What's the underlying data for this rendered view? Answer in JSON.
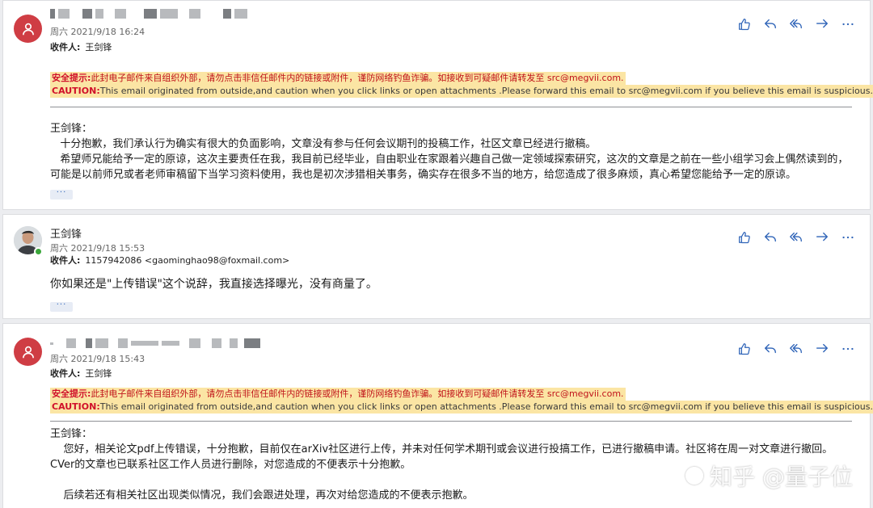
{
  "messages": [
    {
      "date": "周六 2021/9/18 16:24",
      "recipient_label": "收件人:",
      "recipient_value": "王剑锋",
      "security_label": "安全提示:",
      "security_text": "此封电子邮件来自组织外部，请勿点击非信任邮件内的链接或附件，谨防网络钓鱼诈骗。如接收到可疑邮件请转发至 src@megvii.com.",
      "caution_label": "CAUTION:",
      "caution_text": "This email originated from outside,and caution when you click links or open attachments .Please forward this email to src@megvii.com if you believe this email is suspicious.",
      "body": [
        "王剑锋：",
        "   十分抱歉，我们承认行为确实有很大的负面影响，文章没有参与任何会议期刊的投稿工作，社区文章已经进行撤稿。",
        "   希望师兄能给予一定的原谅，这次主要责任在我，我目前已经毕业，自由职业在家跟着兴趣自己做一定领域探索研究，这次的文章是之前在一些小组学习会上偶然读到的，可能是以前师兄或者老师审稿留下当学习资料使用，我也是初次涉猎相关事务，确实存在很多不当的地方，给您造成了很多麻烦，真心希望您能给予一定的原谅。"
      ],
      "more": "···"
    },
    {
      "sender": "王剑锋",
      "date": "周六 2021/9/18 15:53",
      "recipient_label": "收件人:",
      "recipient_value": "1157942086 <gaominghao98@foxmail.com>",
      "body": [
        "你如果还是\"上传错误\"这个说辞，我直接选择曝光，没有商量了。"
      ],
      "more": "···"
    },
    {
      "date": "周六 2021/9/18 15:43",
      "recipient_label": "收件人:",
      "recipient_value": "王剑锋",
      "security_label": "安全提示:",
      "security_text": "此封电子邮件来自组织外部，请勿点击非信任邮件内的链接或附件，谨防网络钓鱼诈骗。如接收到可疑邮件请转发至 src@megvii.com.",
      "caution_label": "CAUTION:",
      "caution_text": "This email originated from outside,and caution when you click links or open attachments .Please forward this email to src@megvii.com if you believe this email is suspicious.",
      "body": [
        "王剑锋：",
        "    您好，相关论文pdf上传错误，十分抱歉，目前仅在arXiv社区进行上传，并未对任何学术期刊或会议进行投搞工作，已进行撤稿申请。社区将在周一对文章进行撤回。CVer的文章也已联系社区工作人员进行删除，对您造成的不便表示十分抱歉。",
        "",
        "    后续若还有相关社区出现类似情况，我们会跟进处理，再次对给您造成的不便表示抱歉。"
      ]
    }
  ],
  "actions": [
    "thumbs-up-icon",
    "reply-icon",
    "reply-all-icon",
    "forward-icon",
    "more-options-icon"
  ],
  "watermark": "知乎 @量子位",
  "colors": {
    "accent": "#2f64b8",
    "avatar_red": "#cf3d44",
    "warning_bg": "#fbe5a4",
    "warning_red": "#c0131a"
  }
}
